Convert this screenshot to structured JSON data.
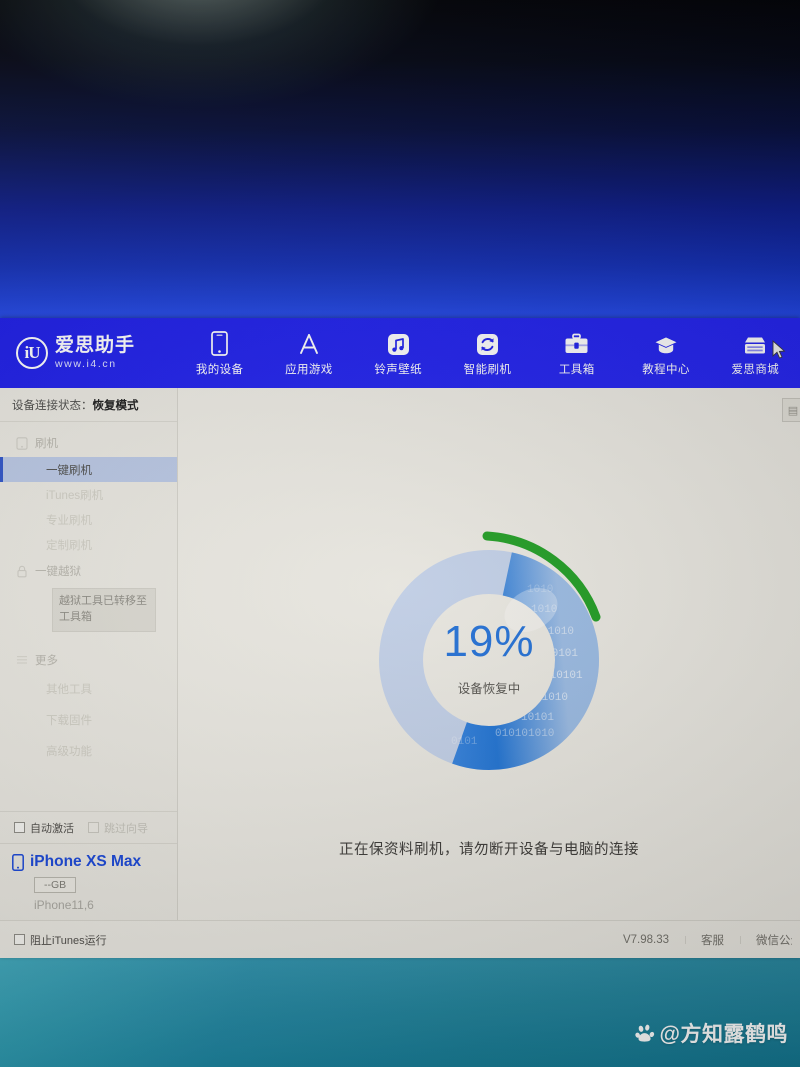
{
  "app": {
    "logo": {
      "mark": "iU",
      "name": "爱思助手",
      "url": "www.i4.cn"
    },
    "cursor_icon": "mouse-cursor-icon"
  },
  "nav": {
    "items": [
      {
        "label": "我的设备",
        "icon": "phone-icon"
      },
      {
        "label": "应用游戏",
        "icon": "app-store-icon"
      },
      {
        "label": "铃声壁纸",
        "icon": "music-note-icon"
      },
      {
        "label": "智能刷机",
        "icon": "refresh-circle-icon"
      },
      {
        "label": "工具箱",
        "icon": "toolbox-icon"
      },
      {
        "label": "教程中心",
        "icon": "graduation-cap-icon"
      },
      {
        "label": "爱思商城",
        "icon": "store-icon"
      }
    ]
  },
  "sidebar": {
    "connection_label": "设备连接状态：",
    "connection_value": "恢复模式",
    "groups": [
      {
        "title": "刷机",
        "icon": "phone-outline-icon",
        "items": [
          {
            "label": "一键刷机",
            "selected": true
          },
          {
            "label": "iTunes刷机",
            "selected": false
          },
          {
            "label": "专业刷机",
            "selected": false
          },
          {
            "label": "定制刷机",
            "selected": false
          }
        ]
      },
      {
        "title": "一键越狱",
        "icon": "lock-icon",
        "tooltip": "越狱工具已转移至工具箱",
        "items": []
      },
      {
        "title": "更多",
        "icon": "menu-lines-icon",
        "items": [
          {
            "label": "其他工具",
            "selected": false
          },
          {
            "label": "下载固件",
            "selected": false
          },
          {
            "label": "高级功能",
            "selected": false
          }
        ]
      }
    ],
    "options": [
      {
        "label": "自动激活",
        "checked": false,
        "disabled": false
      },
      {
        "label": "跳过向导",
        "checked": false,
        "disabled": true
      }
    ],
    "device": {
      "icon": "phone-small-icon",
      "name": "iPhone XS Max",
      "capacity": "--GB",
      "model": "iPhone11,6"
    }
  },
  "content": {
    "progress": {
      "percent": 19,
      "percent_label": "19%",
      "sub_label": "设备恢复中",
      "track_color": "#c4d2ea",
      "fill_color": "#2b7de0",
      "accent_arc_color": "#1f9e22"
    },
    "hint": "正在保资料刷机，请勿断开设备与电脑的连接",
    "panel_tab_icon": "panel-toggle-icon"
  },
  "statusbar": {
    "block_itunes": {
      "label": "阻止iTunes运行",
      "checked": false
    },
    "version": "V7.98.33",
    "support": "客服",
    "wechat": "微信公众号"
  },
  "watermark": {
    "icon": "baidu-paw-icon",
    "text": "@方知露鹤鸣"
  },
  "colors": {
    "brand_blue": "#1818e6",
    "desktop_top": "#04050a",
    "desktop_blue": "#2348e8",
    "desktop_bottom_teal": "#1a8aa8",
    "window_bg": "#eceae3",
    "selected_item": "#b9c7e4",
    "device_name_blue": "#1745d8",
    "percent_blue": "#2170d8"
  }
}
